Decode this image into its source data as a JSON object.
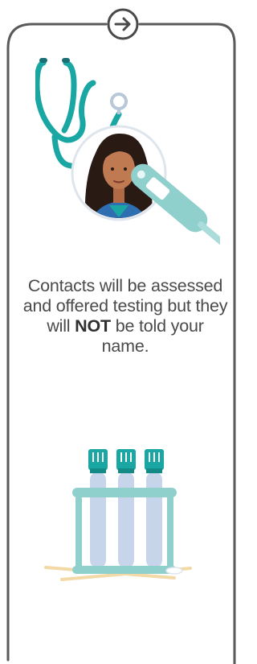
{
  "next_button": {
    "icon": "arrow-right-icon"
  },
  "hero": {
    "icons": [
      "stethoscope-icon",
      "doctor-avatar-icon",
      "thermometer-icon"
    ]
  },
  "message": {
    "before": "Contacts will be assessed and offered testing but they will ",
    "emphasis": "NOT",
    "after": " be told your name."
  },
  "illustration": {
    "icon": "test-tubes-rack-icon"
  },
  "colors": {
    "frame": "#5a5a5a",
    "teal": "#1aa7a3",
    "teal_light": "#8fd0cd",
    "tube": "#c7d5ea",
    "text": "#4a4a4a"
  }
}
